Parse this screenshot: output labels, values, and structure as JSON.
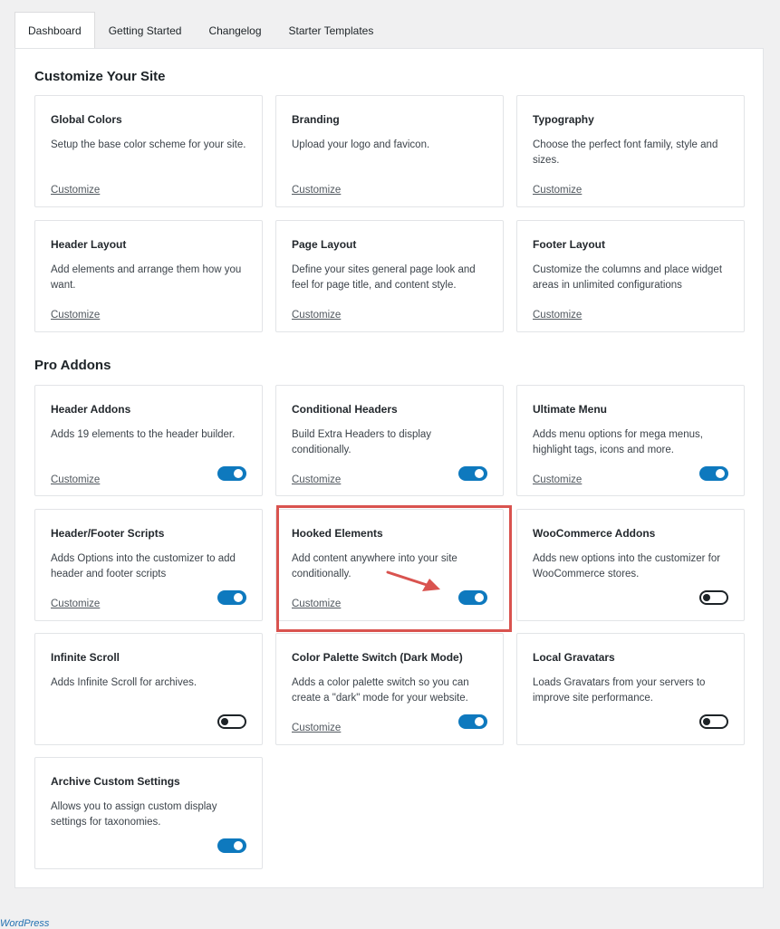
{
  "tabs": [
    {
      "label": "Dashboard",
      "active": true
    },
    {
      "label": "Getting Started",
      "active": false
    },
    {
      "label": "Changelog",
      "active": false
    },
    {
      "label": "Starter Templates",
      "active": false
    }
  ],
  "sections": {
    "customize_title": "Customize Your Site",
    "pro_title": "Pro Addons"
  },
  "customize_cards": [
    {
      "title": "Global Colors",
      "desc": "Setup the base color scheme for your site.",
      "link": "Customize"
    },
    {
      "title": "Branding",
      "desc": "Upload your logo and favicon.",
      "link": "Customize"
    },
    {
      "title": "Typography",
      "desc": "Choose the perfect font family, style and sizes.",
      "link": "Customize"
    },
    {
      "title": "Header Layout",
      "desc": "Add elements and arrange them how you want.",
      "link": "Customize"
    },
    {
      "title": "Page Layout",
      "desc": "Define your sites general page look and feel for page title, and content style.",
      "link": "Customize"
    },
    {
      "title": "Footer Layout",
      "desc": "Customize the columns and place widget areas in unlimited configurations",
      "link": "Customize"
    }
  ],
  "addon_cards": [
    {
      "title": "Header Addons",
      "desc": "Adds 19 elements to the header builder.",
      "link": "Customize",
      "enabled": true
    },
    {
      "title": "Conditional Headers",
      "desc": "Build Extra Headers to display conditionally.",
      "link": "Customize",
      "enabled": true
    },
    {
      "title": "Ultimate Menu",
      "desc": "Adds menu options for mega menus, highlight tags, icons and more.",
      "link": "Customize",
      "enabled": true
    },
    {
      "title": "Header/Footer Scripts",
      "desc": "Adds Options into the customizer to add header and footer scripts",
      "link": "Customize",
      "enabled": true
    },
    {
      "title": "Hooked Elements",
      "desc": "Add content anywhere into your site conditionally.",
      "link": "Customize",
      "enabled": true
    },
    {
      "title": "WooCommerce Addons",
      "desc": "Adds new options into the customizer for WooCommerce stores.",
      "link": "",
      "enabled": false
    },
    {
      "title": "Infinite Scroll",
      "desc": "Adds Infinite Scroll for archives.",
      "link": "",
      "enabled": false
    },
    {
      "title": "Color Palette Switch (Dark Mode)",
      "desc": "Adds a color palette switch so you can create a \"dark\" mode for your website.",
      "link": "Customize",
      "enabled": true
    },
    {
      "title": "Local Gravatars",
      "desc": "Loads Gravatars from your servers to improve site performance.",
      "link": "",
      "enabled": false
    },
    {
      "title": "Archive Custom Settings",
      "desc": "Allows you to assign custom display settings for taxonomies.",
      "link": "",
      "enabled": true
    }
  ],
  "footer": {
    "text": "WordPress"
  },
  "colors": {
    "accent": "#0e79be",
    "highlight": "#d9534f",
    "background": "#f0f0f1"
  },
  "icons": {
    "callout": "arrow-icon"
  }
}
